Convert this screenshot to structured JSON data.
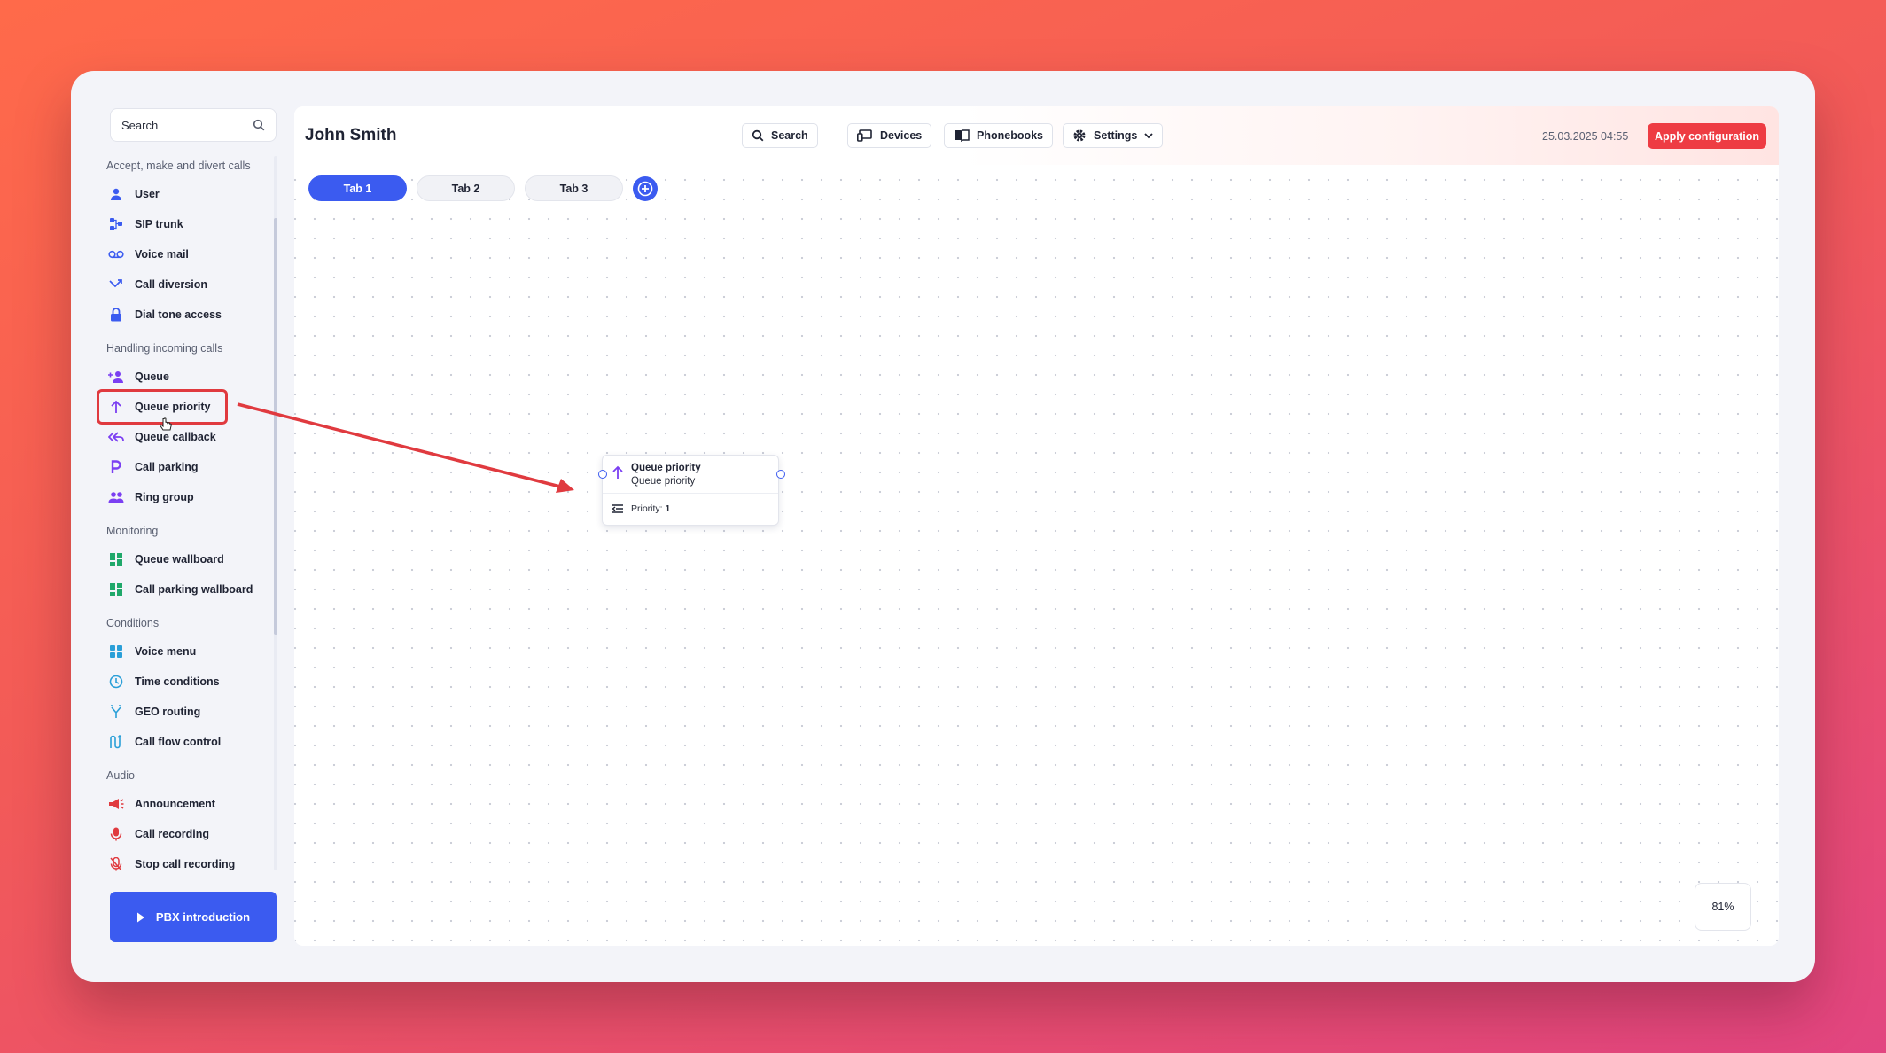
{
  "sidebar": {
    "search_label": "Search",
    "groups": [
      {
        "title": "Accept, make and divert calls",
        "items": [
          {
            "label": "User",
            "icon": "user-icon"
          },
          {
            "label": "SIP trunk",
            "icon": "sip-trunk-icon"
          },
          {
            "label": "Voice mail",
            "icon": "voicemail-icon"
          },
          {
            "label": "Call diversion",
            "icon": "call-diversion-icon"
          },
          {
            "label": "Dial tone access",
            "icon": "lock-icon"
          }
        ]
      },
      {
        "title": "Handling incoming calls",
        "items": [
          {
            "label": "Queue",
            "icon": "queue-icon"
          },
          {
            "label": "Queue priority",
            "icon": "arrow-up-icon",
            "selected": true
          },
          {
            "label": "Queue callback",
            "icon": "callback-icon"
          },
          {
            "label": "Call parking",
            "icon": "parking-icon"
          },
          {
            "label": "Ring group",
            "icon": "ring-group-icon"
          }
        ]
      },
      {
        "title": "Monitoring",
        "items": [
          {
            "label": "Queue wallboard",
            "icon": "wallboard-icon"
          },
          {
            "label": "Call parking wallboard",
            "icon": "wallboard-icon"
          }
        ]
      },
      {
        "title": "Conditions",
        "items": [
          {
            "label": "Voice menu",
            "icon": "voice-menu-icon"
          },
          {
            "label": "Time conditions",
            "icon": "clock-icon"
          },
          {
            "label": "GEO routing",
            "icon": "geo-routing-icon"
          },
          {
            "label": "Call flow control",
            "icon": "call-flow-icon"
          }
        ]
      },
      {
        "title": "Audio",
        "items": [
          {
            "label": "Announcement",
            "icon": "megaphone-icon"
          },
          {
            "label": "Call recording",
            "icon": "microphone-icon"
          },
          {
            "label": "Stop call recording",
            "icon": "microphone-off-icon"
          }
        ]
      }
    ],
    "intro_button": "PBX introduction"
  },
  "header": {
    "user_name": "John Smith",
    "search_label": "Search",
    "devices_label": "Devices",
    "phonebooks_label": "Phonebooks",
    "settings_label": "Settings",
    "datetime": "25.03.2025 04:55",
    "apply_label": "Apply configuration"
  },
  "tabs": [
    {
      "label": "Tab 1",
      "active": true
    },
    {
      "label": "Tab 2",
      "active": false
    },
    {
      "label": "Tab 3",
      "active": false
    }
  ],
  "node": {
    "title": "Queue priority",
    "subtitle": "Queue priority",
    "priority_label": "Priority:",
    "priority_value": "1"
  },
  "zoom": "81%",
  "colors": {
    "accent": "#3b5bf0",
    "apply": "#ee3c43",
    "annotation": "#e03a3f"
  }
}
